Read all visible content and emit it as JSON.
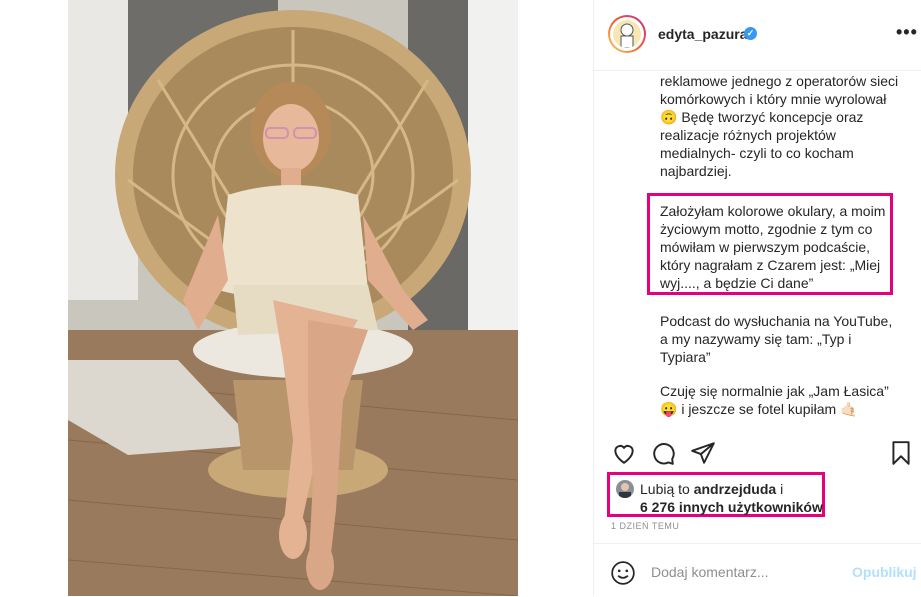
{
  "post": {
    "username": "edyta_pazura",
    "verified_badge": "✓",
    "more_options_label": "•••"
  },
  "caption": {
    "paragraph1": "reklamowe jednego z operatorów sieci komórkowych i który mnie wyrolował 🙃 Będę tworzyć koncepcje oraz realizacje różnych projektów medialnych- czyli to co kocham najbardziej.",
    "paragraph2": "Założyłam kolorowe okulary, a moim życiowym motto, zgodnie z tym co mówiłam w pierwszym podcaście, który nagrałam z Czarem jest: „Miej wyj...., a będzie Ci dane”",
    "paragraph3": "Podcast do wysłuchania na YouTube, a my nazywamy się tam: „Typ i Typiara”",
    "paragraph4": "Czuję się normalnie jak „Jam Łasica” 😛 i jeszcze se fotel kupiłam 🤙🏻"
  },
  "actions": {
    "icons": [
      "heart-icon",
      "comment-icon",
      "share-icon",
      "bookmark-icon"
    ]
  },
  "likes": {
    "prefix": "Lubią to ",
    "liker": "andrzejduda",
    "suffix": " i",
    "others": "6 276 innych użytkowników"
  },
  "timestamp": "1 DZIEŃ TEMU",
  "comment": {
    "placeholder": "Dodaj komentarz...",
    "publish_label": "Opublikuj"
  },
  "colors": {
    "highlight": "#e6007e",
    "verified": "#3897f0",
    "publish_disabled": "#b2dffc"
  }
}
